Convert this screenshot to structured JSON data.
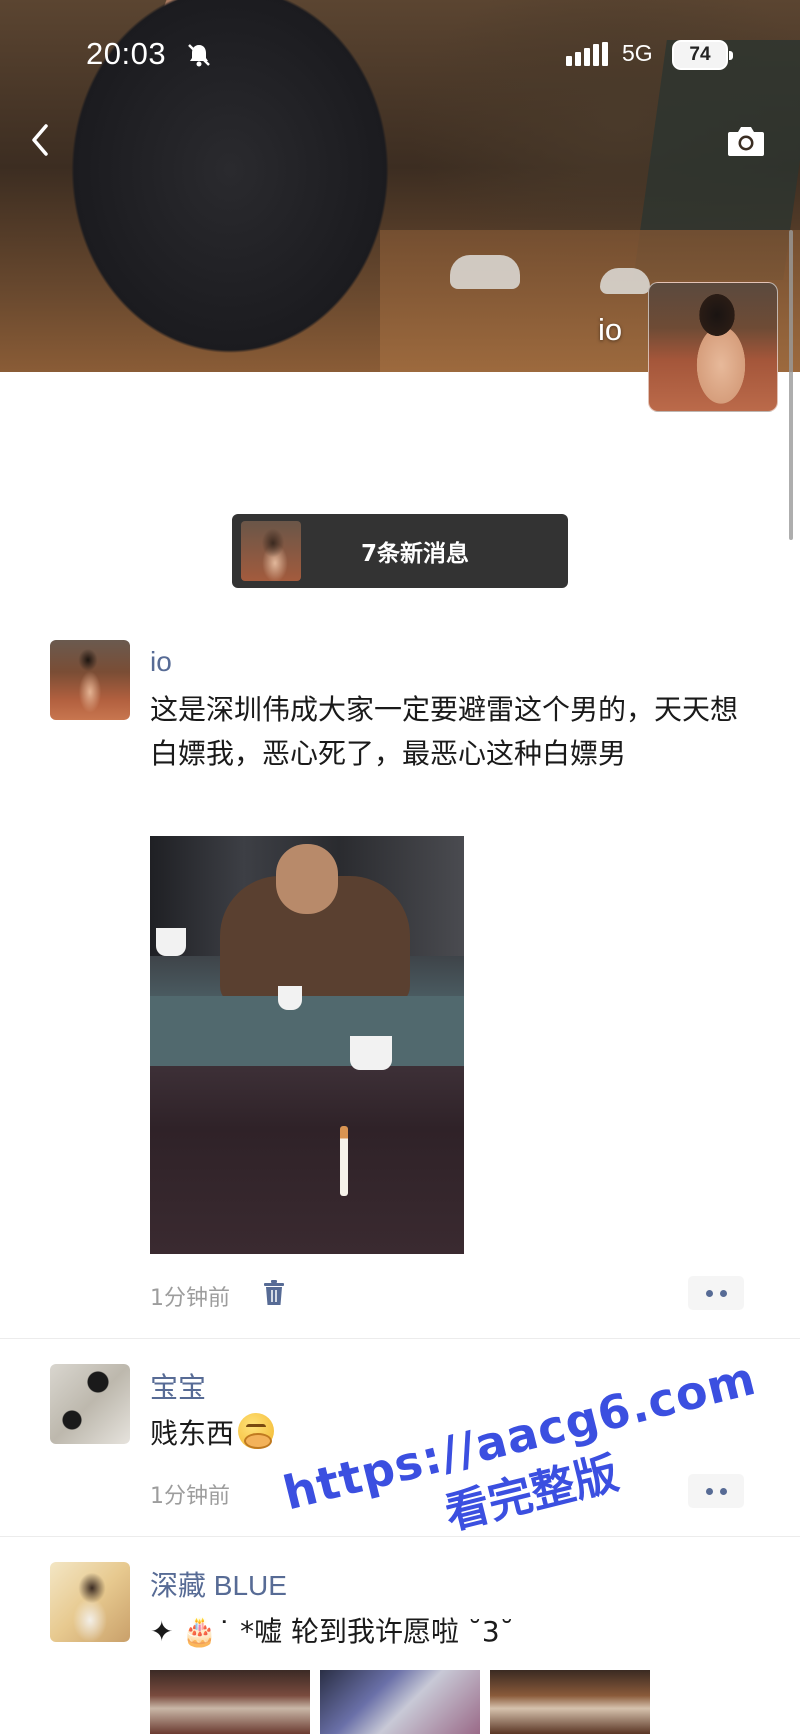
{
  "status_bar": {
    "time": "20:03",
    "network": "5G",
    "battery": "74"
  },
  "header": {
    "profile_name": "io",
    "back_icon": "chevron-left-icon",
    "camera_icon": "camera-icon"
  },
  "new_messages": {
    "label": "7条新消息"
  },
  "posts": [
    {
      "author": "io",
      "text": "这是深圳伟成大家一定要避雷这个男的，天天想白嫖我，恶心死了，最恶心这种白嫖男",
      "time": "1分钟前"
    },
    {
      "author": "宝宝",
      "text": "贱东西",
      "time": "1分钟前"
    },
    {
      "author": "深藏 BLUE",
      "text": "✦ 🎂˙ *嘘 轮到我许愿啦 ˘3˘"
    }
  ],
  "watermark": {
    "url": "https://aacg6.com",
    "sub": "看完整版"
  },
  "colors": {
    "link_blue": "#576b95",
    "pill_bg": "#333333",
    "watermark": "#3b4fe0"
  }
}
